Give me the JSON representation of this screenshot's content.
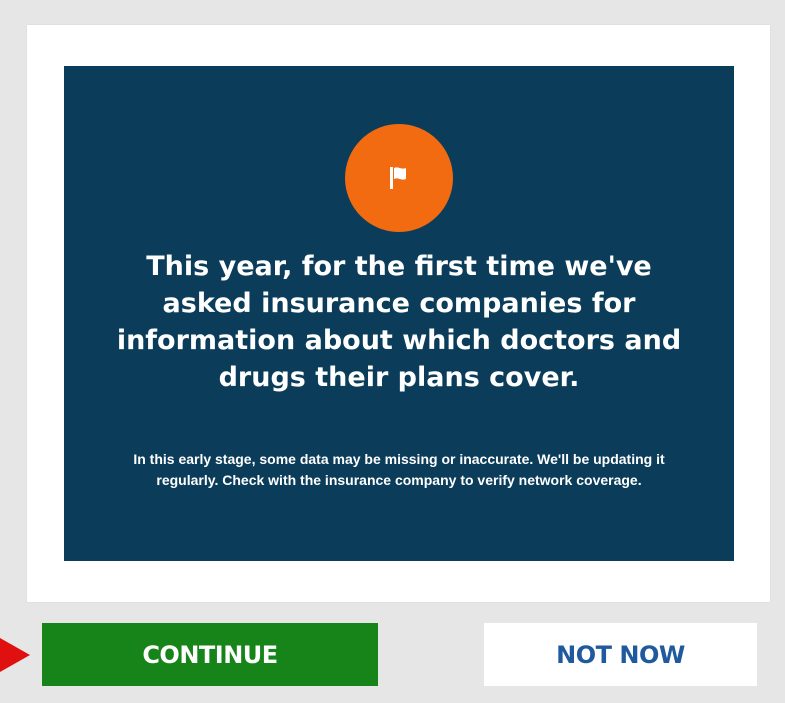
{
  "notice": {
    "icon": "flag-icon",
    "headline": "This year, for the first time we've asked insurance companies for information about which doctors and drugs their plans cover.",
    "subtext": "In this early stage, some data may be missing or inaccurate. We'll be updating it regularly. Check with the insurance company to verify network coverage."
  },
  "actions": {
    "continue_label": "CONTINUE",
    "not_now_label": "NOT NOW"
  },
  "colors": {
    "notice_bg": "#0b3d5b",
    "badge": "#f26b10",
    "continue_bg": "#17841a",
    "not_now_text": "#1f5a9e",
    "pointer": "#e01010"
  }
}
